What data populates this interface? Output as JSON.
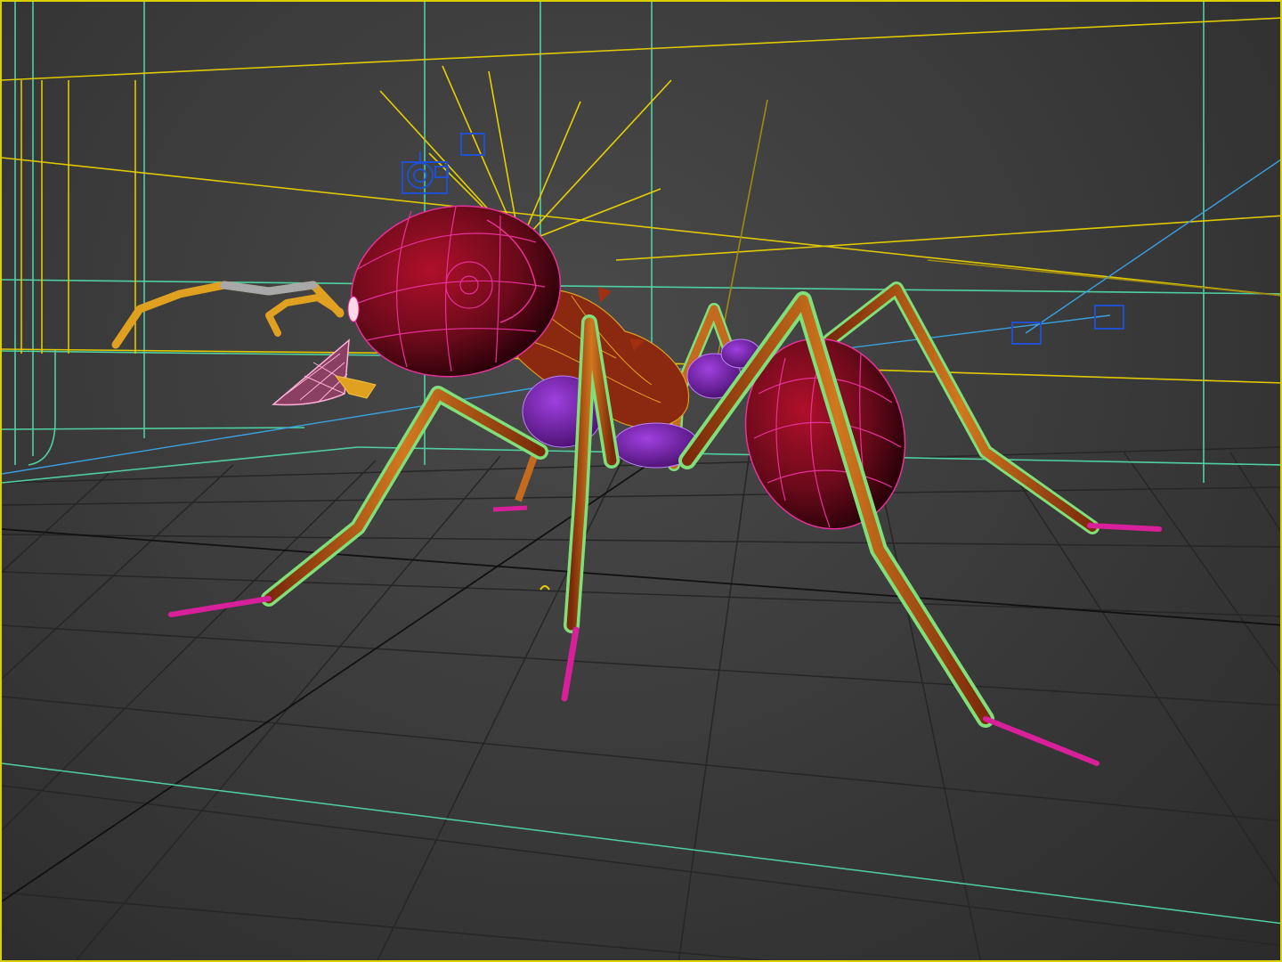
{
  "viewport": {
    "frame_color": "#d8d000",
    "background": "#3c3c3c"
  },
  "scene": {
    "subject": "ant",
    "wire_colors": {
      "body": "#e8309a",
      "legs": "#7fe07a",
      "feet": "#d8209a",
      "limbs_fill": "#c46a1e",
      "body_fill": "#6a0a1a",
      "underbody": "#b040ff",
      "antennae": "#e0a020",
      "lights": "#e8d000",
      "cameras": "#2050d0",
      "grid": "#222222",
      "env_lines": "#50d0a0",
      "light_beam": "#3aa0e0"
    },
    "icons": [
      "camera-icon",
      "light-icon",
      "locator-icon"
    ]
  }
}
